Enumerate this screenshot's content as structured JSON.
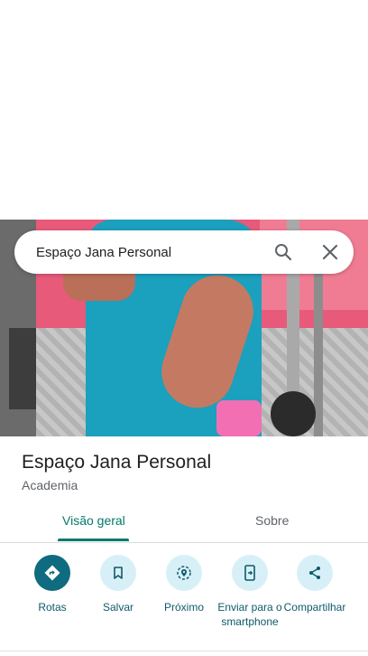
{
  "search": {
    "query": "Espaço Jana Personal"
  },
  "place": {
    "name": "Espaço Jana Personal",
    "category": "Academia"
  },
  "tabs": [
    {
      "label": "Visão geral",
      "active": true
    },
    {
      "label": "Sobre",
      "active": false
    }
  ],
  "actions": [
    {
      "label": "Rotas",
      "icon": "directions-icon"
    },
    {
      "label": "Salvar",
      "icon": "bookmark-icon"
    },
    {
      "label": "Próximo",
      "icon": "nearby-icon"
    },
    {
      "label": "Enviar para o smartphone",
      "icon": "send-to-phone-icon"
    },
    {
      "label": "Compartilhar",
      "icon": "share-icon"
    }
  ],
  "colors": {
    "accent": "#00796b",
    "primary_button": "#0f6b80",
    "button_bg": "#d7f0f8"
  }
}
